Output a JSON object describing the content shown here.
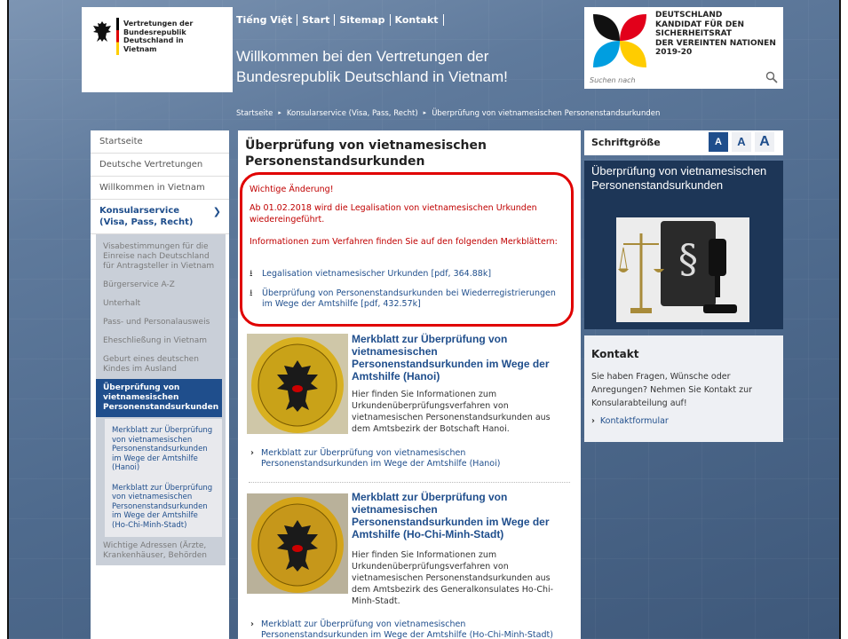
{
  "header": {
    "logo_text": "Vertretungen der Bundesrepublik Deutschland in Vietnam",
    "topnav": [
      "Tiếng Việt",
      "Start",
      "Sitemap",
      "Kontakt"
    ],
    "welcome": "Willkommen bei den Vertretungen der Bundesrepublik Deutschland in Vietnam!",
    "un_lines": [
      "DEUTSCHLAND",
      "KANDIDAT FÜR DEN",
      "SICHERHEITSRAT",
      "DER VEREINTEN NATIONEN",
      "2019-20"
    ],
    "search_placeholder": "Suchen nach"
  },
  "breadcrumb": [
    "Startseite",
    "Konsularservice (Visa, Pass, Recht)",
    "Überprüfung von vietnamesischen Personenstandsurkunden"
  ],
  "leftnav": {
    "items": [
      "Startseite",
      "Deutsche Vertretungen",
      "Willkommen in Vietnam",
      "Konsularservice (Visa, Pass, Recht)"
    ],
    "subitems": [
      "Visabestimmungen für die Einreise nach Deutschland für Antragsteller in Vietnam",
      "Bürgerservice A-Z",
      "Unterhalt",
      "Pass- und Personalausweis",
      "Eheschließung in Vietnam",
      "Geburt eines deutschen Kindes im Ausland",
      "Überprüfung von vietnamesischen Personenstandsurkunden"
    ],
    "subsub": [
      "Merkblatt zur Überprüfung von vietnamesischen Personenstandsurkunden im Wege der Amtshilfe (Hanoi)",
      "Merkblatt zur Überprüfung von vietnamesischen Personenstandsurkunden im Wege der Amtshilfe (Ho-Chi-Minh-Stadt)"
    ],
    "last": "Wichtige Adressen (Ärzte, Krankenhäuser, Behörden"
  },
  "main": {
    "title": "Überprüfung von vietnamesischen Personenstandsurkunden",
    "notice": {
      "heading": "Wichtige Änderung!",
      "line1": "Ab 01.02.2018 wird die Legalisation von vietnamesischen Urkunden wiedereingeführt.",
      "line2": "Informationen zum Verfahren finden Sie auf den folgenden Merkblättern:",
      "link1": "Legalisation vietnamesischer Urkunden [pdf, 364.88k]",
      "link2": "Überprüfung von Personenstandsurkunden bei Wiederregistrierungen im Wege der Amtshilfe [pdf, 432.57k]"
    },
    "cards": [
      {
        "title": "Merkblatt zur Überprüfung von vietnamesischen Personenstandsurkunden im Wege der Amtshilfe (Hanoi)",
        "desc": "Hier finden Sie Informationen zum Urkundenüberprüfungsverfahren von vietnamesischen Personenstandsurkunden aus dem Amtsbezirk der Botschaft Hanoi.",
        "link": "Merkblatt zur Überprüfung von vietnamesischen Personenstandsurkunden im Wege der Amtshilfe (Hanoi)",
        "seal_top": "BUNDESREPUBLIK DEUTSCHLAND",
        "seal_bottom": "BOTSCHAFT"
      },
      {
        "title": "Merkblatt zur Überprüfung von vietnamesischen Personenstandsurkunden im Wege der Amtshilfe (Ho-Chi-Minh-Stadt)",
        "desc": "Hier finden Sie Informationen zum Urkundenüberprüfungsverfahren von vietnamesischen Personenstandsurkunden aus dem Amtsbezirk des Generalkonsulates Ho-Chi-Minh-Stadt.",
        "link": "Merkblatt zur Überprüfung von vietnamesischen Personenstandsurkunden im Wege der Amtshilfe (Ho-Chi-Minh-Stadt)",
        "seal_top": "BUNDESREPUBLIK DEUTSCHLAND",
        "seal_bottom": "GENERALKONSULAT"
      }
    ]
  },
  "right": {
    "fontsize_label": "Schriftgröße",
    "font_buttons": [
      "A",
      "A",
      "A"
    ],
    "promo_title": "Überprüfung von vietnamesischen Personenstandsurkunden",
    "kontakt_title": "Kontakt",
    "kontakt_text": "Sie haben Fragen, Wünsche oder Anregungen? Nehmen Sie Kontakt zur Konsularabteilung auf!",
    "kontakt_link": "Kontaktformular"
  },
  "colors": {
    "accent": "#1f4e8c",
    "notice_border": "#e00000",
    "notice_text": "#c00000",
    "promo_bg": "#1d3657"
  }
}
